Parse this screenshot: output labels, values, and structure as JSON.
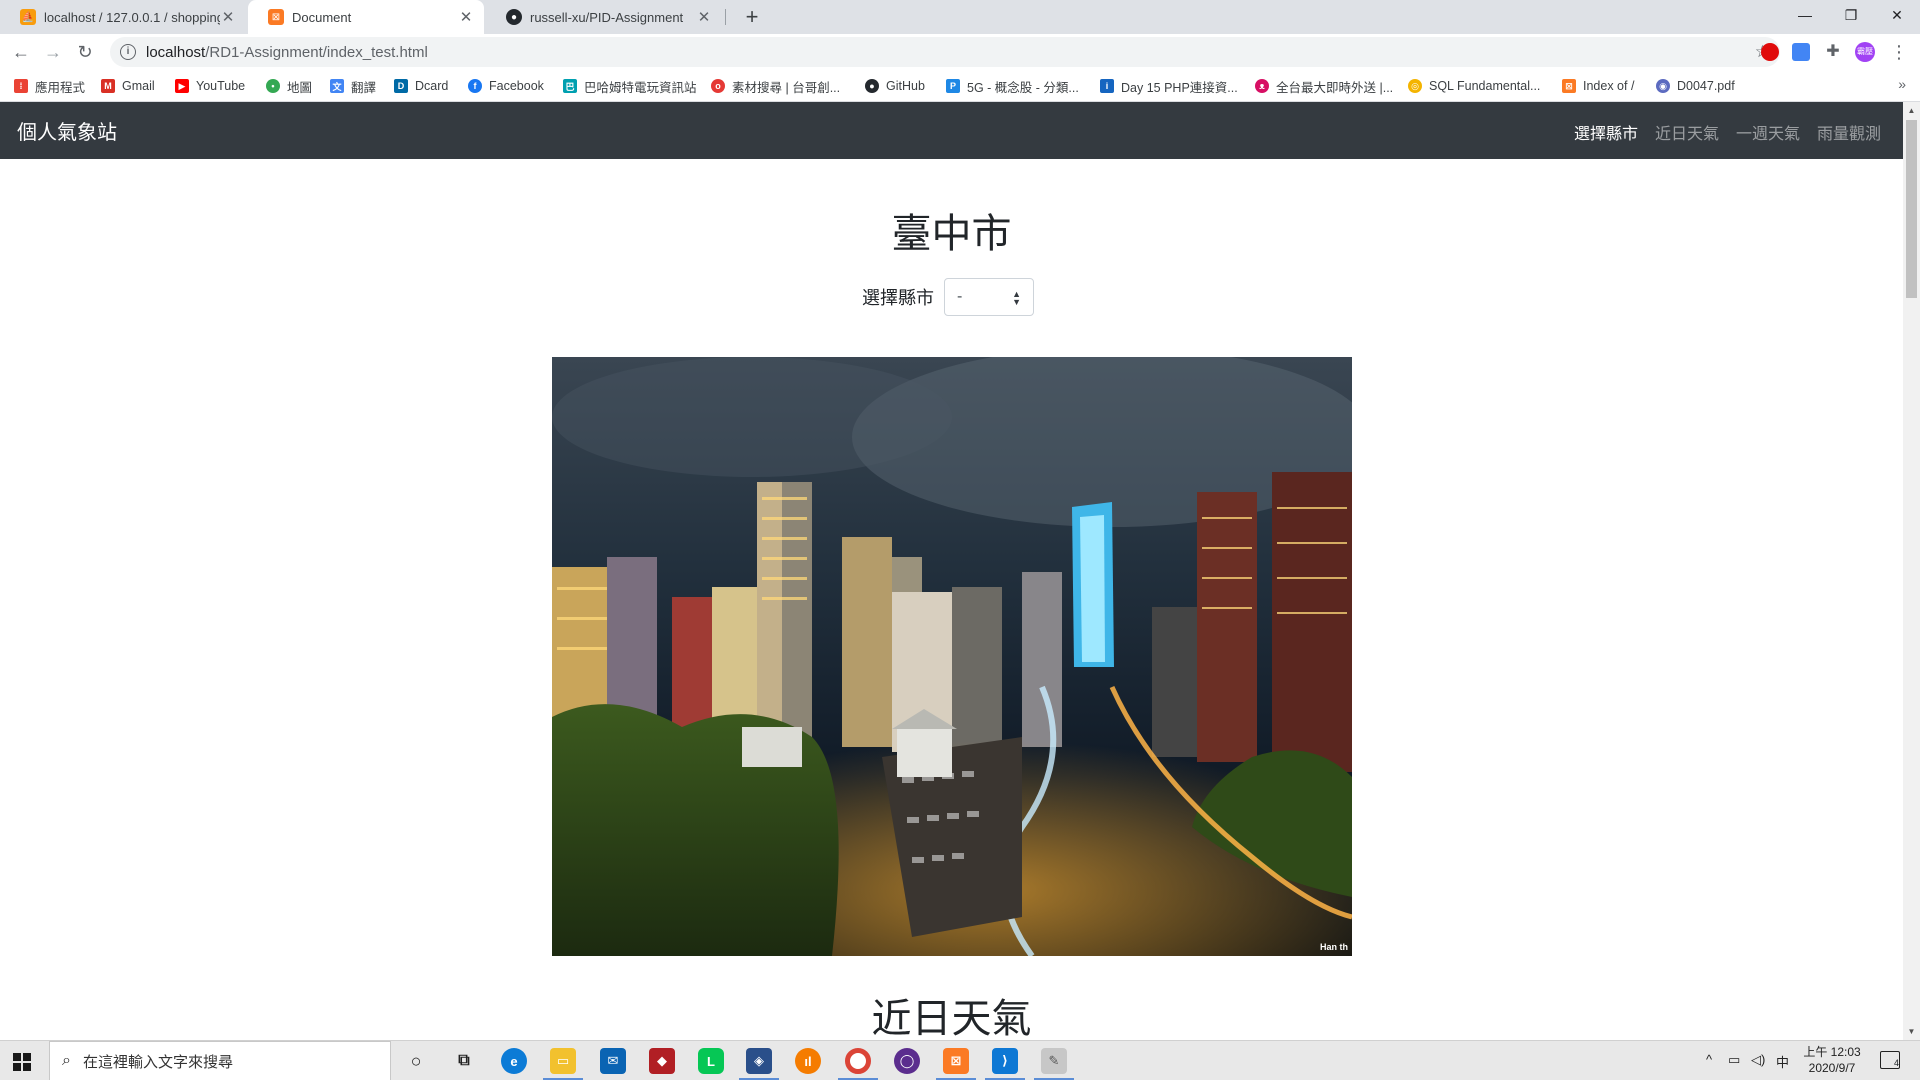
{
  "browser": {
    "tabs": [
      {
        "title": "localhost / 127.0.0.1 / shopping",
        "active": false
      },
      {
        "title": "Document",
        "active": true
      },
      {
        "title": "russell-xu/PID-Assignment",
        "active": false
      }
    ],
    "new_tab_label": "+",
    "close_label": "✕",
    "url_host": "localhost",
    "url_path": "/RD1-Assignment/index_test.html",
    "profile_initials": "霸壓"
  },
  "bookmarks": [
    {
      "label": "應用程式",
      "icon": "apps-grid-icon",
      "color": "#ea4335"
    },
    {
      "label": "Gmail",
      "icon": "gmail-icon",
      "color": "#d93025"
    },
    {
      "label": "YouTube",
      "icon": "youtube-icon",
      "color": "#ff0000"
    },
    {
      "label": "地圖",
      "icon": "maps-pin-icon",
      "color": "#34a853"
    },
    {
      "label": "翻譯",
      "icon": "translate-icon",
      "color": "#4285f4"
    },
    {
      "label": "Dcard",
      "icon": "dcard-icon",
      "color": "#006aa6"
    },
    {
      "label": "Facebook",
      "icon": "facebook-icon",
      "color": "#1877f2"
    },
    {
      "label": "巴哈姆特電玩資訊站",
      "icon": "bahamut-icon",
      "color": "#00a0b0"
    },
    {
      "label": "素材搜尋 | 台哥創...",
      "icon": "search-site-icon",
      "color": "#e53935"
    },
    {
      "label": "GitHub",
      "icon": "github-icon",
      "color": "#24292e"
    },
    {
      "label": "5G - 概念股 - 分類...",
      "icon": "p-site-icon",
      "color": "#1e88e5"
    },
    {
      "label": "Day 15 PHP連接資...",
      "icon": "ithome-icon",
      "color": "#1565c0"
    },
    {
      "label": "全台最大即時外送 |...",
      "icon": "panda-icon",
      "color": "#d70f64"
    },
    {
      "label": "SQL Fundamental...",
      "icon": "sql-icon",
      "color": "#f4b400"
    },
    {
      "label": "Index of /",
      "icon": "xampp-icon",
      "color": "#fb7a24"
    },
    {
      "label": "D0047.pdf",
      "icon": "pdf-icon",
      "color": "#5c6bc0"
    }
  ],
  "site": {
    "brand": "個人氣象站",
    "nav": [
      {
        "label": "選擇縣市",
        "active": true
      },
      {
        "label": "近日天氣",
        "active": false
      },
      {
        "label": "一週天氣",
        "active": false
      },
      {
        "label": "雨量觀測",
        "active": false
      }
    ],
    "city_title": "臺中市",
    "select_label": "選擇縣市",
    "select_value": "-",
    "image_watermark": "Han th",
    "section_title": "近日天氣"
  },
  "taskbar": {
    "search_placeholder": "在這裡輸入文字來搜尋",
    "tray_ime": "中",
    "time": "上午 12:03",
    "date": "2020/9/7",
    "notification_count": "4"
  }
}
